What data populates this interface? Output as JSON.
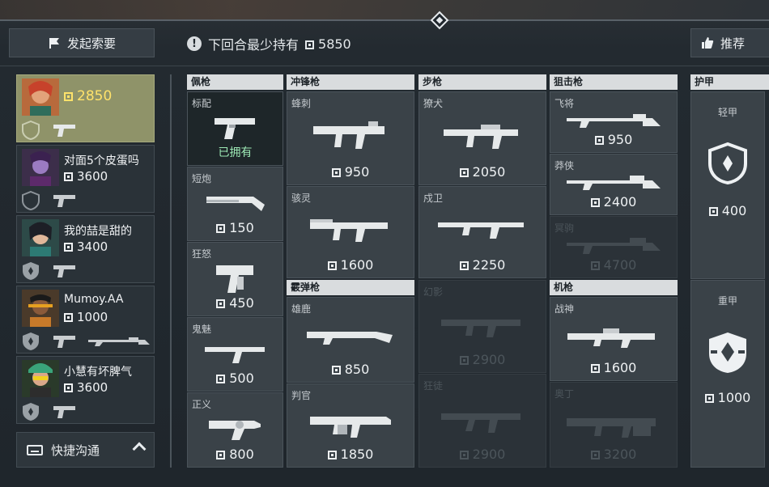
{
  "header": {
    "request_label": "发起索要",
    "min_hold_label": "下回合最少持有",
    "min_hold_value": "5850",
    "recommend_label": "推荐"
  },
  "players": [
    {
      "name": "",
      "credits": "2850",
      "self": true
    },
    {
      "name": "对面5个皮蛋吗",
      "credits": "3600"
    },
    {
      "name": "我的喆是甜的",
      "credits": "3400"
    },
    {
      "name": "Mumoy.AA",
      "credits": "1000"
    },
    {
      "name": "小慧有坏脾气",
      "credits": "3600"
    }
  ],
  "quick_comm_label": "快捷沟通",
  "categories": {
    "sidearms": "佩枪",
    "smgs": "冲锋枪",
    "rifles": "步枪",
    "snipers": "狙击枪",
    "shotguns": "霰弹枪",
    "machine_guns": "机枪",
    "armor": "护甲"
  },
  "sidearms": [
    {
      "name": "标配",
      "price": "",
      "status": "已拥有"
    },
    {
      "name": "短炮",
      "price": "150"
    },
    {
      "name": "狂怒",
      "price": "450"
    },
    {
      "name": "鬼魅",
      "price": "500"
    },
    {
      "name": "正义",
      "price": "800"
    }
  ],
  "smgs": [
    {
      "name": "蜂刺",
      "price": "950"
    },
    {
      "name": "骇灵",
      "price": "1600"
    }
  ],
  "shotguns": [
    {
      "name": "雄鹿",
      "price": "850"
    },
    {
      "name": "判官",
      "price": "1850"
    }
  ],
  "rifles": [
    {
      "name": "獠犬",
      "price": "2050"
    },
    {
      "name": "戍卫",
      "price": "2250"
    },
    {
      "name": "幻影",
      "price": "2900"
    },
    {
      "name": "狂徒",
      "price": "2900"
    }
  ],
  "snipers": [
    {
      "name": "飞将",
      "price": "950"
    },
    {
      "name": "莽侠",
      "price": "2400"
    },
    {
      "name": "冥驹",
      "price": "4700"
    }
  ],
  "machine_guns": [
    {
      "name": "战神",
      "price": "1600"
    },
    {
      "name": "奥丁",
      "price": "3200"
    }
  ],
  "armor": [
    {
      "name": "轻甲",
      "price": "400"
    },
    {
      "name": "重甲",
      "price": "1000"
    }
  ],
  "colors": {
    "credits_self": "#ffe26a",
    "owned_text": "#9de9b5",
    "self_card": "#8f9369"
  }
}
